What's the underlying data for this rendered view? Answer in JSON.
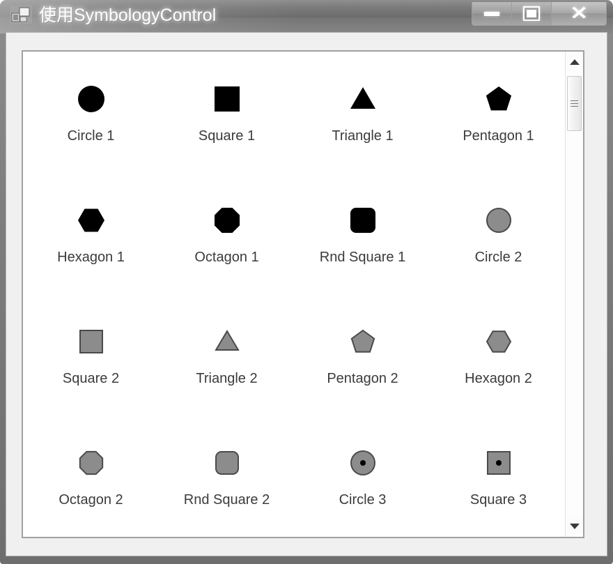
{
  "window": {
    "title": "使用SymbologyControl",
    "icon": "winforms-designer-icon",
    "caption_buttons": [
      {
        "name": "minimize",
        "glyph": "—"
      },
      {
        "name": "maximize",
        "glyph": "□"
      },
      {
        "name": "close",
        "glyph": "✕"
      }
    ]
  },
  "colors": {
    "black_fill": "#000000",
    "gray_fill": "#8c8c8c",
    "gray_outline": "#4a4a4a",
    "label_text": "#3b3b3b",
    "panel_background": "#ffffff",
    "panel_border": "#a0a0a0",
    "client_background": "#f0f0f0",
    "titlebar_gradient_top": "#8f8f8f",
    "titlebar_gradient_bottom": "#868686"
  },
  "symbology": {
    "scrollbar": {
      "up_arrow": "scroll-up-arrow",
      "down_arrow": "scroll-down-arrow",
      "thumb": "scroll-thumb"
    },
    "symbols": [
      {
        "label": "Circle 1",
        "shape": "circle",
        "style": "solid-black",
        "fill": "#000000",
        "stroke": "none",
        "center_dot": false
      },
      {
        "label": "Square 1",
        "shape": "square",
        "style": "solid-black",
        "fill": "#000000",
        "stroke": "none",
        "center_dot": false
      },
      {
        "label": "Triangle 1",
        "shape": "triangle",
        "style": "solid-black",
        "fill": "#000000",
        "stroke": "none",
        "center_dot": false
      },
      {
        "label": "Pentagon 1",
        "shape": "pentagon",
        "style": "solid-black",
        "fill": "#000000",
        "stroke": "none",
        "center_dot": false
      },
      {
        "label": "Hexagon 1",
        "shape": "hexagon",
        "style": "solid-black",
        "fill": "#000000",
        "stroke": "none",
        "center_dot": false
      },
      {
        "label": "Octagon 1",
        "shape": "octagon",
        "style": "solid-black",
        "fill": "#000000",
        "stroke": "none",
        "center_dot": false
      },
      {
        "label": "Rnd Square 1",
        "shape": "rnd-square",
        "style": "solid-black",
        "fill": "#000000",
        "stroke": "none",
        "center_dot": false
      },
      {
        "label": "Circle 2",
        "shape": "circle",
        "style": "gray-outline",
        "fill": "#8c8c8c",
        "stroke": "#4a4a4a",
        "center_dot": false
      },
      {
        "label": "Square 2",
        "shape": "square",
        "style": "gray-outline",
        "fill": "#8c8c8c",
        "stroke": "#4a4a4a",
        "center_dot": false
      },
      {
        "label": "Triangle 2",
        "shape": "triangle",
        "style": "gray-outline",
        "fill": "#8c8c8c",
        "stroke": "#4a4a4a",
        "center_dot": false
      },
      {
        "label": "Pentagon 2",
        "shape": "pentagon",
        "style": "gray-outline",
        "fill": "#8c8c8c",
        "stroke": "#4a4a4a",
        "center_dot": false
      },
      {
        "label": "Hexagon 2",
        "shape": "hexagon",
        "style": "gray-outline",
        "fill": "#8c8c8c",
        "stroke": "#4a4a4a",
        "center_dot": false
      },
      {
        "label": "Octagon 2",
        "shape": "octagon",
        "style": "gray-outline",
        "fill": "#8c8c8c",
        "stroke": "#4a4a4a",
        "center_dot": false
      },
      {
        "label": "Rnd Square 2",
        "shape": "rnd-square",
        "style": "gray-outline",
        "fill": "#8c8c8c",
        "stroke": "#4a4a4a",
        "center_dot": false
      },
      {
        "label": "Circle 3",
        "shape": "circle",
        "style": "gray-dot",
        "fill": "#8c8c8c",
        "stroke": "#4a4a4a",
        "center_dot": true
      },
      {
        "label": "Square 3",
        "shape": "square",
        "style": "gray-dot",
        "fill": "#8c8c8c",
        "stroke": "#4a4a4a",
        "center_dot": true
      }
    ]
  }
}
